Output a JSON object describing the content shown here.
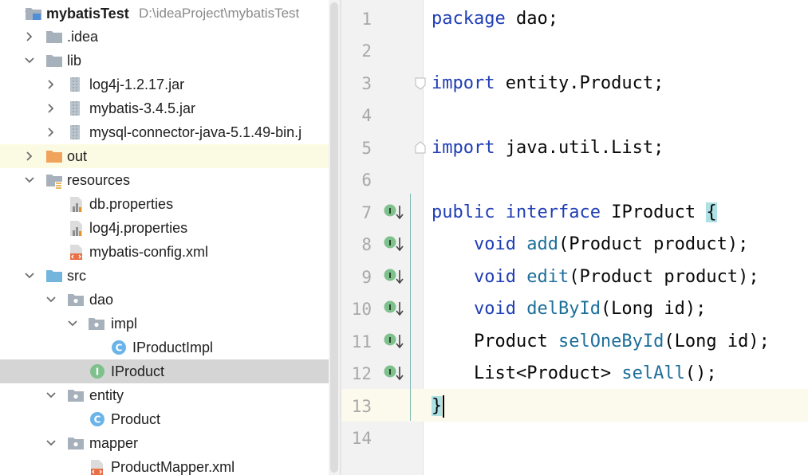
{
  "tree": {
    "rows": [
      {
        "label": "mybatisTest",
        "path": "D:\\ideaProject\\mybatisTest"
      },
      {
        "label": ".idea"
      },
      {
        "label": "lib"
      },
      {
        "label": "log4j-1.2.17.jar"
      },
      {
        "label": "mybatis-3.4.5.jar"
      },
      {
        "label": "mysql-connector-java-5.1.49-bin.j"
      },
      {
        "label": "out"
      },
      {
        "label": "resources"
      },
      {
        "label": "db.properties"
      },
      {
        "label": "log4j.properties"
      },
      {
        "label": "mybatis-config.xml"
      },
      {
        "label": "src"
      },
      {
        "label": "dao"
      },
      {
        "label": "impl"
      },
      {
        "label": "IProductImpl"
      },
      {
        "label": "IProduct"
      },
      {
        "label": "entity"
      },
      {
        "label": "Product"
      },
      {
        "label": "mapper"
      },
      {
        "label": "ProductMapper.xml"
      }
    ]
  },
  "editor": {
    "line_numbers": [
      "1",
      "2",
      "3",
      "4",
      "5",
      "6",
      "7",
      "8",
      "9",
      "10",
      "11",
      "12",
      "13",
      "14"
    ],
    "code": {
      "l1_kw": "package",
      "l1_rest": " dao;",
      "l3_kw": "import",
      "l3_rest": " entity.Product;",
      "l5_kw": "import",
      "l5_rest": " java.util.List;",
      "l7_kw1": "public",
      "l7_kw2": "interface",
      "l7_name": " IProduct ",
      "l7_brace": "{",
      "l8_kw": "void",
      "l8_fn": "add",
      "l8_rest": "(Product product);",
      "l9_kw": "void",
      "l9_fn": "edit",
      "l9_rest": "(Product product);",
      "l10_kw": "void",
      "l10_fn": "delById",
      "l10_rest": "(Long id);",
      "l11_type": "Product ",
      "l11_fn": "selOneById",
      "l11_rest": "(Long id);",
      "l12_type": "List<Product> ",
      "l12_fn": "selAll",
      "l12_rest": "();",
      "l13_brace": "}"
    },
    "impl_marker_letter": "I"
  },
  "colors": {
    "keyword": "#1f3eb5",
    "method": "#1d6f9b",
    "selection": "#d5d5d5",
    "brace_match": "#aee1e4",
    "folder": "#a7b1bb",
    "source_folder": "#74b5de",
    "excluded_folder": "#f0a35b"
  }
}
